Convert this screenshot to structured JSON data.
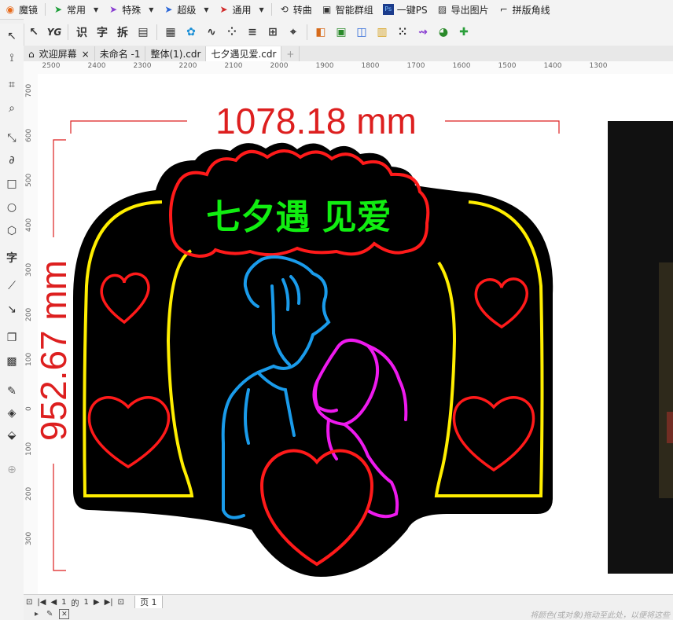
{
  "menubar": {
    "items": [
      {
        "label": "魔镜",
        "icon": "mirror-icon",
        "color": "#e86a1a"
      },
      {
        "label": "常用",
        "icon": "arrow-icon",
        "color": "#1e9e3a",
        "caret": true
      },
      {
        "label": "特殊",
        "icon": "arrow-icon",
        "color": "#8a3fd1",
        "caret": true
      },
      {
        "label": "超级",
        "icon": "arrow-icon",
        "color": "#2a66d8",
        "caret": true
      },
      {
        "label": "通用",
        "icon": "arrow-icon",
        "color": "#d12a2a",
        "caret": true
      },
      {
        "label": "转曲",
        "icon": "curve-icon",
        "color": "#333333"
      },
      {
        "label": "智能群组",
        "icon": "group-icon",
        "color": "#333333"
      },
      {
        "label": "一键PS",
        "icon": "ps-icon",
        "color": "#1c3c8c"
      },
      {
        "label": "导出图片",
        "icon": "image-icon",
        "color": "#333333"
      },
      {
        "label": "拼版角线",
        "icon": "crop-marks-icon",
        "color": "#333333"
      }
    ]
  },
  "toolbar2": {
    "text_tools": [
      "识",
      "字",
      "拆"
    ]
  },
  "tabs": [
    {
      "label": "欢迎屏幕",
      "closable": true,
      "home": true
    },
    {
      "label": "未命名 -1"
    },
    {
      "label": "整体(1).cdr"
    },
    {
      "label": "七夕遇见爱.cdr",
      "active": true
    }
  ],
  "rulers": {
    "h_labels": [
      "2500",
      "2400",
      "2300",
      "2200",
      "2100",
      "2000",
      "1900",
      "1800",
      "1700",
      "1600",
      "1500",
      "1400",
      "1300"
    ],
    "v_labels": [
      "700",
      "600",
      "500",
      "400",
      "300",
      "200",
      "100",
      "0",
      "100",
      "200",
      "300"
    ]
  },
  "artwork": {
    "width_dim": "1078.18 mm",
    "height_dim": "952.67 mm",
    "title": "七夕遇 见爱",
    "colors": {
      "dimension": "#dd1f1f",
      "border": "#ffee00",
      "heart": "#ff1a1a",
      "boy": "#1a9bea",
      "girl": "#ee1aee",
      "title": "#11ee11",
      "background": "#000000"
    }
  },
  "pagebar": {
    "page_current": "1",
    "page_of": "的",
    "page_total": "1",
    "page_tab": "页 1"
  },
  "status": {
    "hint": "将颜色(或对象)拖动至此处，以便将这些"
  }
}
